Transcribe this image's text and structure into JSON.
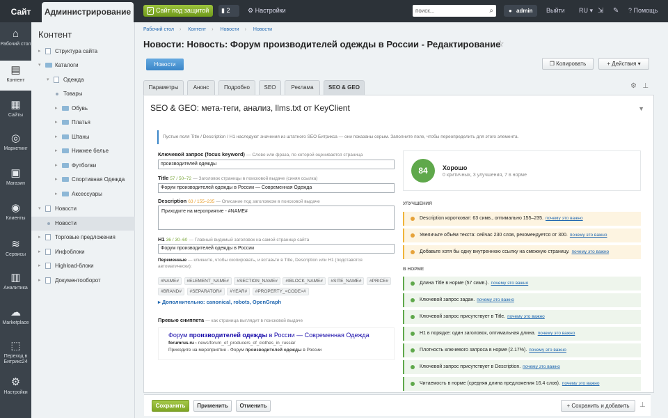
{
  "topbar": {
    "site": "Сайт",
    "admin": "Администрирование",
    "protected": "Сайт под защитой",
    "notif_count": "2",
    "settings": "Настройки",
    "search_placeholder": "поиск...",
    "user": "admin",
    "exit": "Выйти",
    "lang": "RU",
    "help": "Помощь"
  },
  "leftnav": [
    {
      "label": "Рабочий стол",
      "icon": "home-icon"
    },
    {
      "label": "Контент",
      "icon": "document-icon",
      "active": true
    },
    {
      "label": "Сайты",
      "icon": "calendar-24-icon"
    },
    {
      "label": "Маркетинг",
      "icon": "target-icon"
    },
    {
      "label": "Магазин",
      "icon": "cart-icon"
    },
    {
      "label": "Клиенты",
      "icon": "clients-24-icon"
    },
    {
      "label": "Сервисы",
      "icon": "layers-icon"
    },
    {
      "label": "Аналитика",
      "icon": "chart-icon"
    },
    {
      "label": "Marketplace",
      "icon": "cloud-download-icon"
    },
    {
      "label": "Переход в Битрикс24",
      "icon": "bitrix24-icon"
    },
    {
      "label": "Настройки",
      "icon": "gear-icon"
    }
  ],
  "tree": {
    "title": "Контент",
    "items": [
      {
        "label": "Структура сайта"
      },
      {
        "label": "Каталоги"
      },
      {
        "label": "Одежда"
      },
      {
        "label": "Товары"
      },
      {
        "label": "Обувь"
      },
      {
        "label": "Платья"
      },
      {
        "label": "Штаны"
      },
      {
        "label": "Нижнее белье"
      },
      {
        "label": "Футболки"
      },
      {
        "label": "Спортивная Одежда"
      },
      {
        "label": "Аксессуары"
      },
      {
        "label": "Новости"
      },
      {
        "label": "Новости"
      },
      {
        "label": "Торговые предложения"
      },
      {
        "label": "Инфоблоки"
      },
      {
        "label": "Highload-блоки"
      },
      {
        "label": "Документооборот"
      }
    ]
  },
  "breadcrumb": [
    "Рабочий стол",
    "Контент",
    "Новости",
    "Новости"
  ],
  "page_title": "Новости: Новость: Форум производителей одежды в России - Редактирование",
  "buttons": {
    "news": "Новости",
    "copy": "Копировать",
    "actions": "Действия"
  },
  "tabs": [
    "Параметры",
    "Анонс",
    "Подробно",
    "SEO",
    "Реклама",
    "SEO & GEO"
  ],
  "panel": {
    "title": "SEO & GEO: мета-теги, анализ, llms.txt от KeyClient",
    "hint": "Пустые поля Title / Description / H1 наследуют значения из штатного SEO Битрикса — они показаны серым. Заполните поле, чтобы переопределить для этого элемента.",
    "kw_label": "Ключевой запрос (focus keyword)",
    "kw_sub": "— Слово или фраза, по которой оценивается страница",
    "kw_value": "производителей одежды",
    "title_label": "Title",
    "title_cnt": "57 / 50–72",
    "title_sub": "— Заголовок страницы в поисковой выдаче (синяя ссылка)",
    "title_value": "Форум производителей одежды в России — Современная Одежда",
    "desc_label": "Description",
    "desc_cnt": "63 / 155–235",
    "desc_sub": "— Описание под заголовком в поисковой выдаче",
    "desc_value": "Приходите на мероприятие - #NAME#",
    "h1_label": "H1",
    "h1_cnt": "36 / 30–60",
    "h1_sub": "— Главный видимый заголовок на самой странице сайта",
    "h1_value": "Форум производителей одежды в России",
    "vars_label": "Переменные",
    "vars_sub": "— кликните, чтобы скопировать, и вставьте в Title, Description или H1 (подставятся автоматически):",
    "vars": [
      "#NAME#",
      "#ELEMENT_NAME#",
      "#SECTION_NAME#",
      "#IBLOCK_NAME#",
      "#SITE_NAME#",
      "#PRICE#",
      "#BRAND#",
      "#SEPARATOR#",
      "#YEAR#",
      "#PROPERTY_<CODE>#"
    ],
    "more": "Дополнительно: canonical, robots, OpenGraph",
    "preview_label": "Превью сниппета",
    "preview_sub": "— как страница выглядит в поисковой выдаче",
    "snippet_title_a": "Форум ",
    "snippet_title_b": "производителей одежды",
    "snippet_title_c": " в России — Современная Одежда",
    "snippet_domain": "forumrus.ru",
    "snippet_path": " › news/forum_of_producers_of_clothes_in_russia/",
    "snippet_desc_a": "Приходите на мероприятие - Форум ",
    "snippet_desc_b": "производителей одежды",
    "snippet_desc_c": " в России",
    "score": "84",
    "score_label": "Хорошо",
    "score_sub": "0 критичных, 3 улучшения, 7 в норме",
    "improve_title": "УЛУЧШЕНИЯ",
    "improve": [
      {
        "text": "Description коротковат: 63 симв., оптимально 155–235.",
        "link": "почему это важно"
      },
      {
        "text": "Увеличьте объём текста: сейчас 230 слов, рекомендуется от 300.",
        "link": "почему это важно"
      },
      {
        "text": "Добавьте хотя бы одну внутреннюю ссылку на смежную страницу.",
        "link": "почему это важно"
      }
    ],
    "ok_title": "В НОРМЕ",
    "ok": [
      {
        "text": "Длина Title в норме (57 симв.).",
        "link": "почему это важно"
      },
      {
        "text": "Ключевой запрос задан.",
        "link": "почему это важно"
      },
      {
        "text": "Ключевой запрос присутствует в Title.",
        "link": "почему это важно"
      },
      {
        "text": "H1 в порядке: один заголовок, оптимальная длина.",
        "link": "почему это важно"
      },
      {
        "text": "Плотность ключевого запроса в норме (2.17%).",
        "link": "почему это важно"
      },
      {
        "text": "Ключевой запрос присутствует в Description.",
        "link": "почему это важно"
      },
      {
        "text": "Читаемость в норме (средняя длина предложения 16.4 слов).",
        "link": "почему это важно"
      }
    ]
  },
  "footer": {
    "save": "Сохранить",
    "apply": "Применить",
    "cancel": "Отменить",
    "save_add": "Сохранить и добавить"
  }
}
